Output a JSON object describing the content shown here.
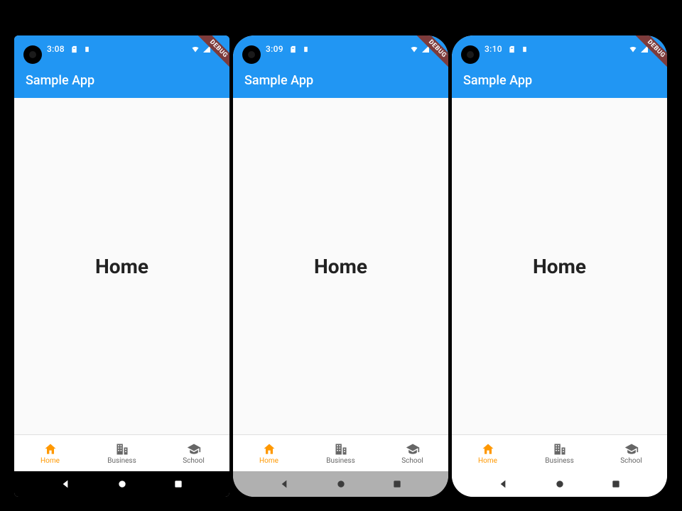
{
  "app": {
    "title": "Sample App",
    "debug_label": "DEBUG"
  },
  "content": {
    "heading": "Home"
  },
  "bottom_nav": {
    "items": [
      {
        "label": "Home"
      },
      {
        "label": "Business"
      },
      {
        "label": "School"
      }
    ]
  },
  "phones": [
    {
      "time": "3:08",
      "sys_nav_theme": "black",
      "corners": "square"
    },
    {
      "time": "3:09",
      "sys_nav_theme": "gray",
      "corners": "rounded"
    },
    {
      "time": "3:10",
      "sys_nav_theme": "white",
      "corners": "rounded"
    }
  ]
}
